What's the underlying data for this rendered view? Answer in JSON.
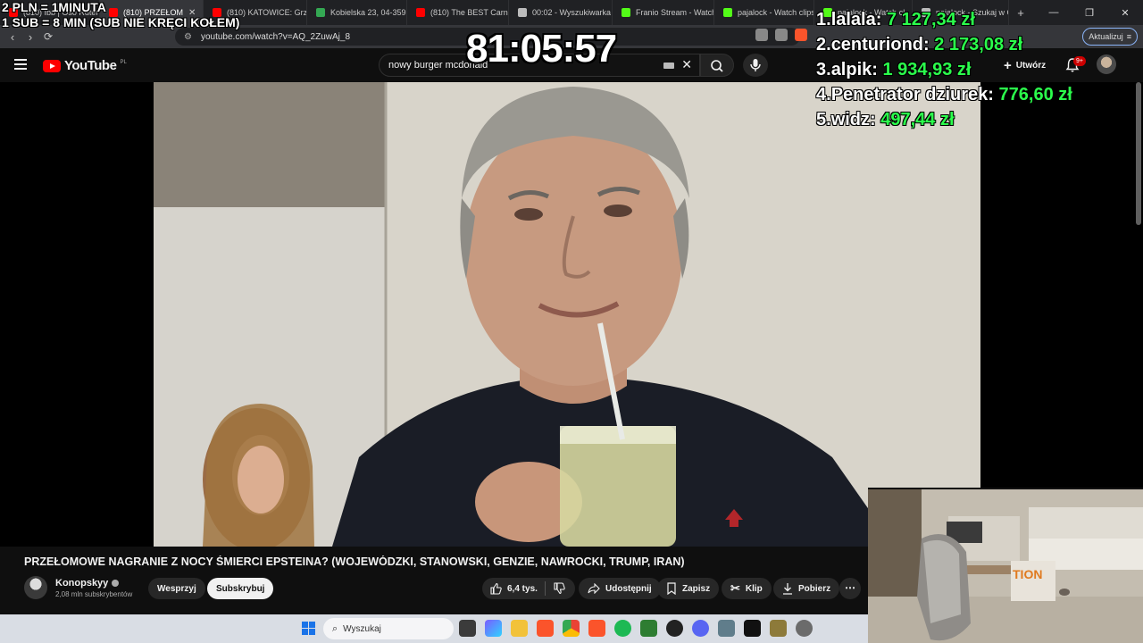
{
  "browser": {
    "tabs": [
      {
        "label": "(810) Ibb | Oso Ruter Hum",
        "color": "#ff0000"
      },
      {
        "label": "(810) PRZEŁOM",
        "color": "#ff0000",
        "active": true
      },
      {
        "label": "(810) KATOWICE: Grze",
        "color": "#ff0000"
      },
      {
        "label": "Kobielska 23, 04-359 W",
        "color": "#34a853"
      },
      {
        "label": "(810) The BEST Carnita",
        "color": "#ff0000"
      },
      {
        "label": "00:02 - Wyszukiwarka",
        "color": "#bbbbbb"
      },
      {
        "label": "Franio Stream - Watch",
        "color": "#53fc18"
      },
      {
        "label": "pajalock - Watch clips",
        "color": "#53fc18"
      },
      {
        "label": "pajalock - Watch cl",
        "color": "#53fc18"
      },
      {
        "label": "pajalock - Szukaj w G",
        "color": "#bbbbbb"
      }
    ],
    "url": "youtube.com/watch?v=AQ_2ZuwAj_8",
    "update_label": "Aktualizuj"
  },
  "youtube": {
    "logo_text": "YouTube",
    "region": "PL",
    "search_query": "nowy burger mcdonald",
    "create_label": "Utwórz",
    "notif_count": "9+"
  },
  "video": {
    "title": "PRZEŁOMOWE NAGRANIE Z NOCY ŚMIERCI EPSTEINA? (WOJEWÓDZKI, STANOWSKI, GENZIE, NAWROCKI, TRUMP, IRAN)",
    "channel": "Konopskyy",
    "subscribers": "2,08 mln subskrybentów",
    "support_label": "Wesprzyj",
    "subscribe_label": "Subskrybuj",
    "likes": "6,4 tys.",
    "share_label": "Udostępnij",
    "save_label": "Zapisz",
    "clip_label": "Klip",
    "download_label": "Pobierz"
  },
  "taskbar": {
    "search_placeholder": "Wyszukaj"
  },
  "overlay": {
    "rate_line1": "2 PLN = 1MINUTA",
    "rate_line2": "1 SUB = 8 MIN (SUB NIE KRĘCI KOŁEM)",
    "timer": "81:05:57",
    "leaderboard": [
      {
        "rank": "1.",
        "name": "lalala:",
        "amount": "7 127,34 zł"
      },
      {
        "rank": "2.",
        "name": "centuriond:",
        "amount": "2 173,08 zł"
      },
      {
        "rank": "3.",
        "name": "alpik:",
        "amount": "1 934,93 zł"
      },
      {
        "rank": "4.",
        "name": "Penetrator dziurek:",
        "amount": "776,60 zł"
      },
      {
        "rank": "5.",
        "name": "widz:",
        "amount": "497,44 zł"
      }
    ]
  },
  "colors": {
    "yt_red": "#ff0000",
    "amount_green": "#2bff4c"
  }
}
